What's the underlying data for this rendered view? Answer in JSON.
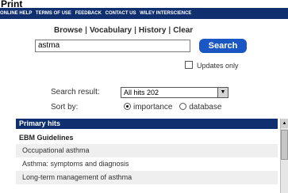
{
  "caption": "Print",
  "topnav": {
    "items": [
      "ONLINE HELP",
      "TERMS OF USE",
      "FEEDBACK",
      "CONTACT US",
      "WILEY INTERSCIENCE"
    ]
  },
  "menu": {
    "browse": "Browse",
    "vocabulary": "Vocabulary",
    "history": "History",
    "clear": "Clear",
    "separator": "|"
  },
  "search": {
    "value": "astma",
    "button_label": "Search",
    "updates_only_label": "Updates only"
  },
  "search_result": {
    "label": "Search result:",
    "selected": "All hits 202"
  },
  "sort_by": {
    "label": "Sort by:",
    "options": [
      "importance",
      "database"
    ],
    "selected": "importance"
  },
  "results": {
    "section_title": "Primary hits",
    "group_title": "EBM Guidelines",
    "items": [
      "Occupational asthma",
      "Asthma: symptoms and diagnosis",
      "Long-term management of asthma"
    ]
  }
}
